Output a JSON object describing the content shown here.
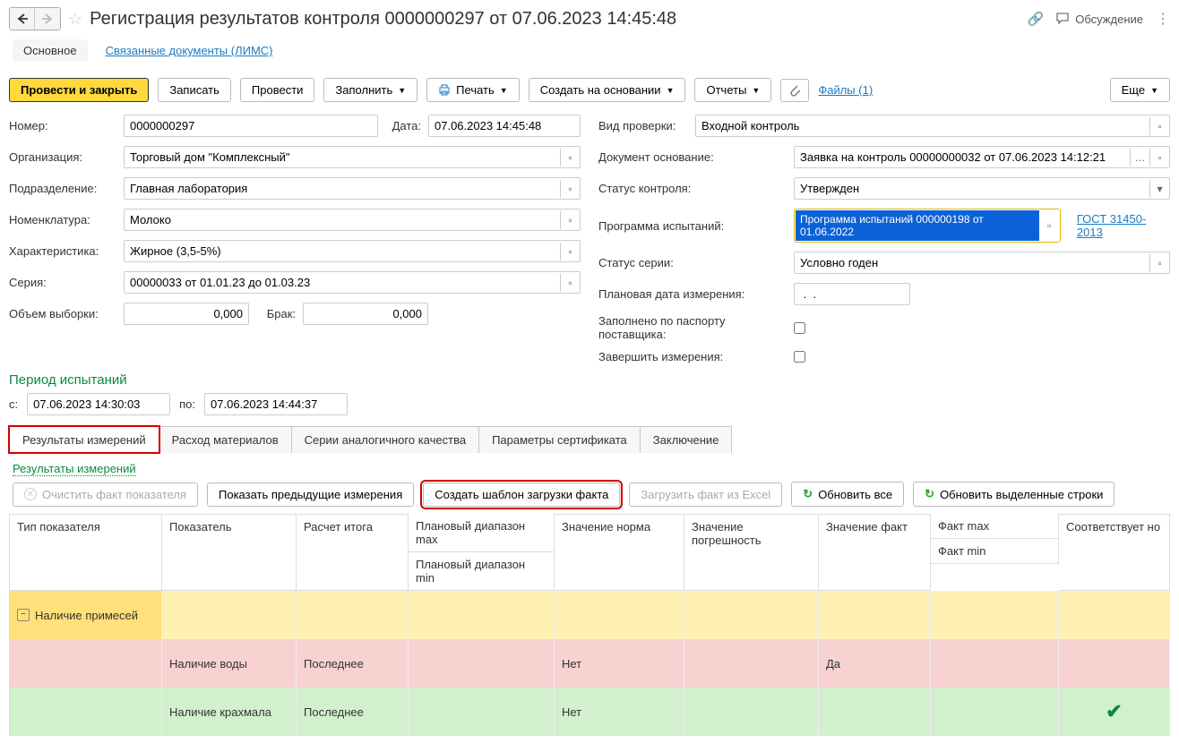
{
  "page_title": "Регистрация результатов контроля 0000000297 от 07.06.2023 14:45:48",
  "discuss_label": "Обсуждение",
  "nav_tabs": {
    "main": "Основное",
    "linked": "Связанные документы (ЛИМС)"
  },
  "toolbar": {
    "post_close": "Провести и закрыть",
    "save": "Записать",
    "post": "Провести",
    "fill": "Заполнить",
    "print": "Печать",
    "create_based": "Создать на основании",
    "reports": "Отчеты",
    "files": "Файлы (1)",
    "more": "Еще"
  },
  "left": {
    "number_lbl": "Номер:",
    "number_val": "0000000297",
    "org_lbl": "Организация:",
    "org_val": "Торговый дом \"Комплексный\"",
    "dept_lbl": "Подразделение:",
    "dept_val": "Главная лаборатория",
    "nom_lbl": "Номенклатура:",
    "nom_val": "Молоко",
    "char_lbl": "Характеристика:",
    "char_val": "Жирное (3,5-5%)",
    "series_lbl": "Серия:",
    "series_val": "00000033 от 01.01.23 до 01.03.23",
    "sample_lbl": "Объем выборки:",
    "sample_val": "0,000",
    "defect_lbl": "Брак:",
    "defect_val": "0,000"
  },
  "right": {
    "date_lbl": "Дата:",
    "date_val": "07.06.2023 14:45:48",
    "check_lbl": "Вид проверки:",
    "check_val": "Входной контроль",
    "basis_lbl": "Документ основание:",
    "basis_val": "Заявка на контроль 00000000032 от 07.06.2023 14:12:21",
    "status_lbl": "Статус контроля:",
    "status_val": "Утвержден",
    "prog_lbl": "Программа испытаний:",
    "prog_val": "Программа испытаний 000000198 от 01.06.2022",
    "gost": "ГОСТ 31450-2013",
    "sstatus_lbl": "Статус серии:",
    "sstatus_val": "Условно годен",
    "plan_lbl": "Плановая дата измерения:",
    "plan_val": " .  .",
    "passport_lbl": "Заполнено по паспорту поставщика:",
    "finish_lbl": "Завершить измерения:"
  },
  "period": {
    "title": "Период испытаний",
    "from_lbl": "с:",
    "from_val": "07.06.2023 14:30:03",
    "to_lbl": "по:",
    "to_val": "07.06.2023 14:44:37"
  },
  "tabs": {
    "t1": "Результаты измерений",
    "t2": "Расход материалов",
    "t3": "Серии аналогичного качества",
    "t4": "Параметры сертификата",
    "t5": "Заключение"
  },
  "sub_link": "Результаты измерений",
  "actions": {
    "clear": "Очистить факт показателя",
    "prev": "Показать предыдущие измерения",
    "tpl": "Создать шаблон загрузки факта",
    "load": "Загрузить факт из Excel",
    "upd_all": "Обновить все",
    "upd_sel": "Обновить выделенные строки"
  },
  "thead": {
    "type": "Тип показателя",
    "ind": "Показатель",
    "calc": "Расчет итога",
    "plan_max": "Плановый диапазон max",
    "plan_min": "Плановый диапазон min",
    "norm": "Значение норма",
    "err": "Значение погрешность",
    "fact": "Значение факт",
    "fact_max": "Факт max",
    "fact_min": "Факт min",
    "match": "Соответствует но"
  },
  "rows": {
    "r1_type": "Наличие примесей",
    "r2_ind": "Наличие воды",
    "r2_calc": "Последнее",
    "r2_norm": "Нет",
    "r2_fact": "Да",
    "r3_ind": "Наличие крахмала",
    "r3_calc": "Последнее",
    "r3_norm": "Нет"
  }
}
